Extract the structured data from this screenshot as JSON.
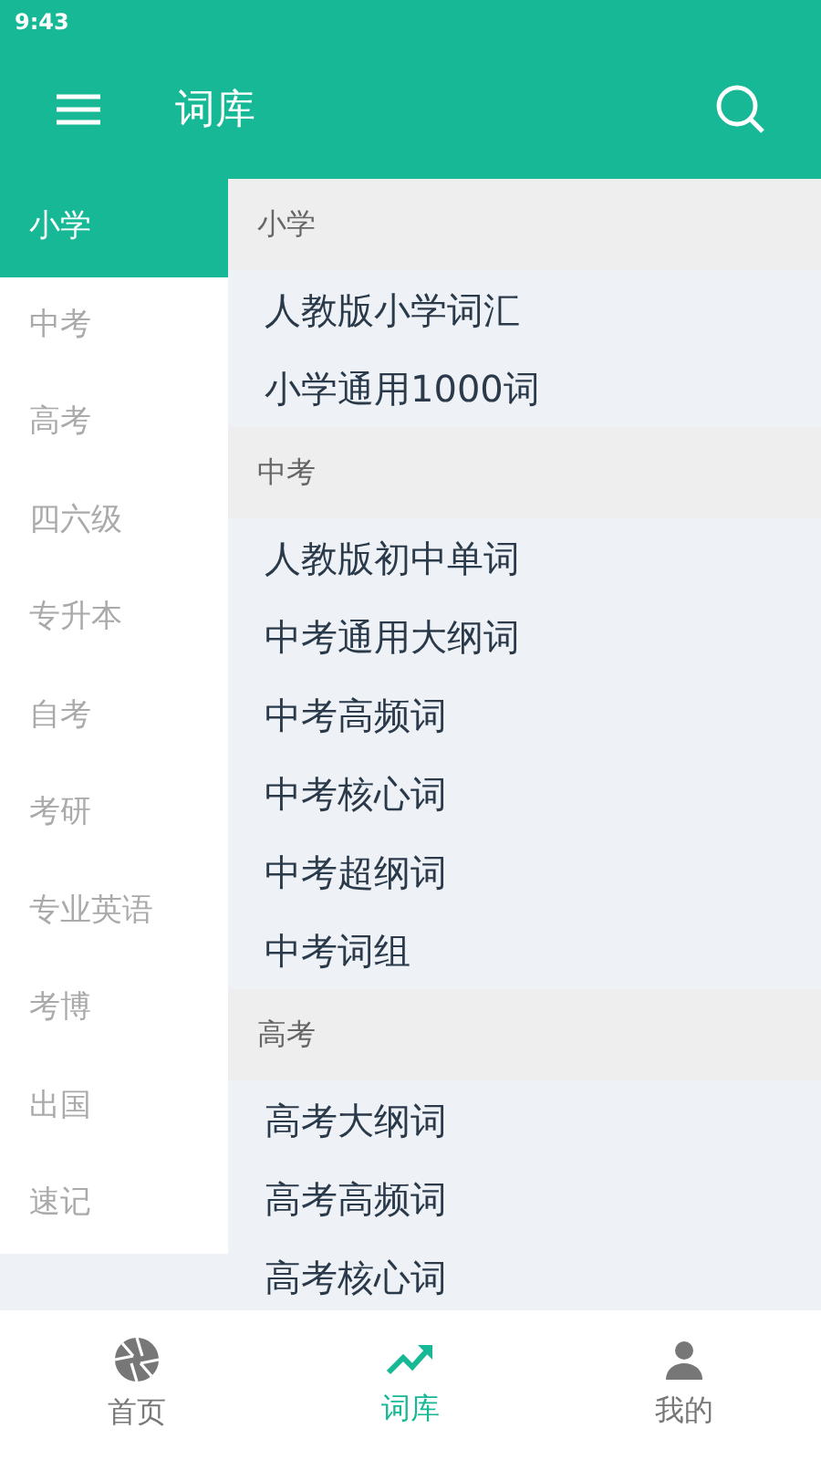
{
  "status_bar": {
    "time": "9:43"
  },
  "toolbar": {
    "title": "词库"
  },
  "sidebar": {
    "items": [
      {
        "label": "小学",
        "selected": true
      },
      {
        "label": "中考",
        "selected": false
      },
      {
        "label": "高考",
        "selected": false
      },
      {
        "label": "四六级",
        "selected": false
      },
      {
        "label": "专升本",
        "selected": false
      },
      {
        "label": "自考",
        "selected": false
      },
      {
        "label": "考研",
        "selected": false
      },
      {
        "label": "专业英语",
        "selected": false
      },
      {
        "label": "考博",
        "selected": false
      },
      {
        "label": "出国",
        "selected": false
      },
      {
        "label": "速记",
        "selected": false
      }
    ]
  },
  "sections": [
    {
      "title": "小学",
      "items": [
        "人教版小学词汇",
        "小学通用1000词"
      ]
    },
    {
      "title": "中考",
      "items": [
        "人教版初中单词",
        "中考通用大纲词",
        "中考高频词",
        "中考核心词",
        "中考超纲词",
        "中考词组"
      ]
    },
    {
      "title": "高考",
      "items": [
        "高考大纲词",
        "高考高频词",
        "高考核心词"
      ]
    }
  ],
  "bottom_nav": [
    {
      "label": "首页",
      "kind": "home",
      "selected": false
    },
    {
      "label": "词库",
      "kind": "wordbook",
      "selected": true
    },
    {
      "label": "我的",
      "kind": "profile",
      "selected": false
    }
  ]
}
